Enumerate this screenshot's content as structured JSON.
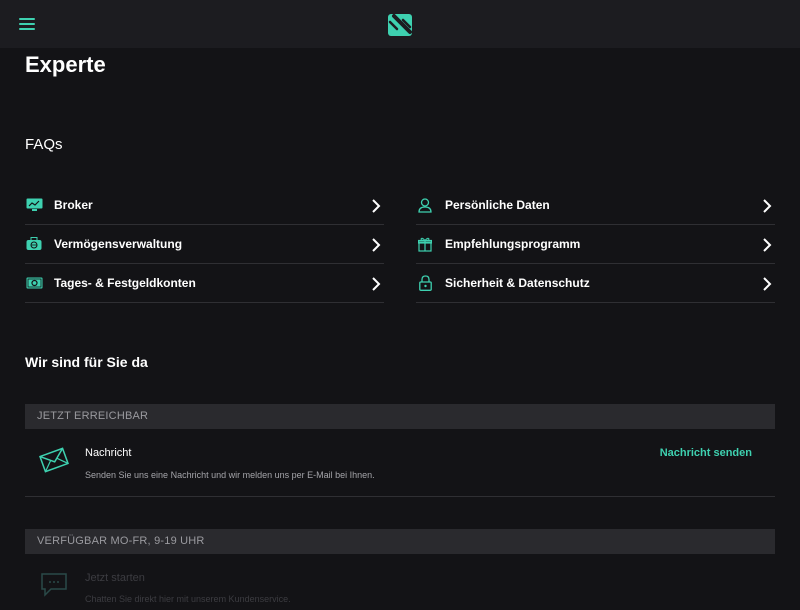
{
  "header": {
    "menu_icon": "hamburger-menu-icon",
    "logo_icon": "brand-s-logo-icon",
    "accent_color": "#3ed1b0"
  },
  "page": {
    "title": "Experte"
  },
  "faqs": {
    "heading": "FAQs",
    "left": [
      {
        "label": "Broker",
        "icon": "monitor-chart-icon"
      },
      {
        "label": "Vermögensverwaltung",
        "icon": "briefcase-globe-icon"
      },
      {
        "label": "Tages- & Festgeldkonten",
        "icon": "banknote-icon"
      }
    ],
    "right": [
      {
        "label": "Persönliche Daten",
        "icon": "user-icon"
      },
      {
        "label": "Empfehlungsprogramm",
        "icon": "gift-icon"
      },
      {
        "label": "Sicherheit & Datenschutz",
        "icon": "padlock-icon"
      }
    ]
  },
  "support": {
    "heading": "Wir sind für Sie da",
    "reachable_band": "JETZT ERREICHBAR",
    "message": {
      "title": "Nachricht",
      "description": "Senden Sie uns eine Nachricht und wir melden uns per E-Mail bei Ihnen.",
      "action": "Nachricht senden",
      "icon": "envelope-icon"
    },
    "hours_band": "VERFÜGBAR MO-FR, 9-19 UHR",
    "chat": {
      "title": "Jetzt starten",
      "description": "Chatten Sie direkt hier mit unserem Kundenservice.",
      "icon": "chat-bubble-icon"
    }
  }
}
